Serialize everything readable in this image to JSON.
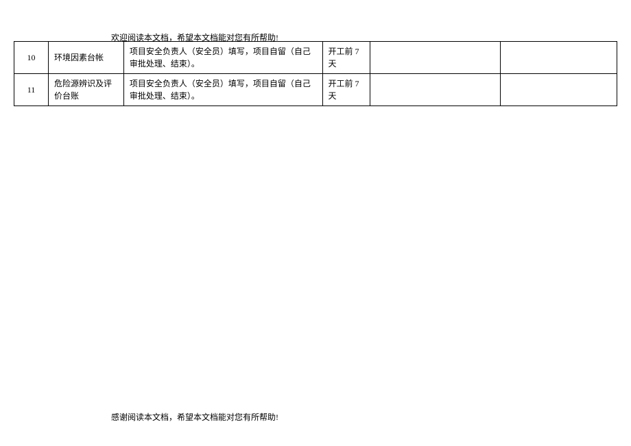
{
  "headerText": "欢迎阅读本文档，希望本文档能对您有所帮助!",
  "footerText": "感谢阅读本文档，希望本文档能对您有所帮助!",
  "rows": [
    {
      "num": "10",
      "name": "环境因素台帐",
      "desc": "项目安全负责人（安全员）填写，项目自留（自己审批处理、结束）。",
      "time": "开工前 7 天",
      "empty1": "",
      "empty2": ""
    },
    {
      "num": "11",
      "name": "危险源辨识及评价台账",
      "desc": "项目安全负责人（安全员）填写，项目自留（自己审批处理、结束）。",
      "time": "开工前 7 天",
      "empty1": "",
      "empty2": ""
    }
  ]
}
